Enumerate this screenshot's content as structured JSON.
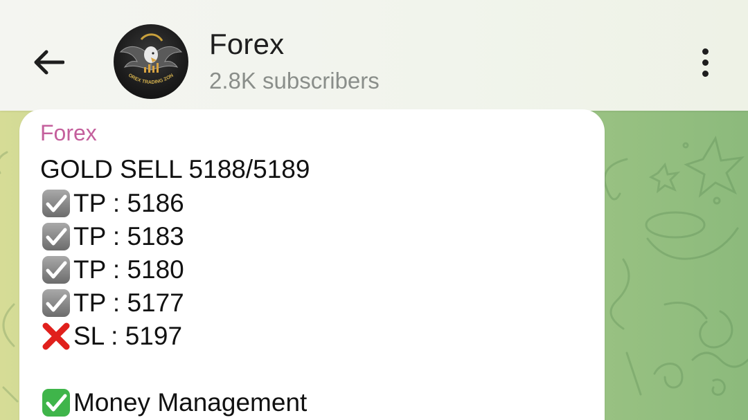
{
  "header": {
    "title": "Forex",
    "subtitle": "2.8K subscribers",
    "avatar_logo_text": "FOREX TRADING ZONE"
  },
  "message": {
    "sender": "Forex",
    "headline": "GOLD SELL 5188/5189",
    "targets": [
      {
        "label": "TP : 5186",
        "icon": "check-box-icon"
      },
      {
        "label": "TP : 5183",
        "icon": "check-box-icon"
      },
      {
        "label": "TP : 5180",
        "icon": "check-box-icon"
      },
      {
        "label": "TP : 5177",
        "icon": "check-box-icon"
      }
    ],
    "stop_loss": {
      "label": "SL : 5197",
      "icon": "cross-mark-icon"
    },
    "footer_line": {
      "label": "Money Management",
      "icon": "green-check-icon"
    }
  },
  "colors": {
    "sender": "#c45f9c",
    "wallpaper_left": "#d6dc96",
    "wallpaper_right": "#8cba7c",
    "header_bg": "#f2f4ee"
  }
}
